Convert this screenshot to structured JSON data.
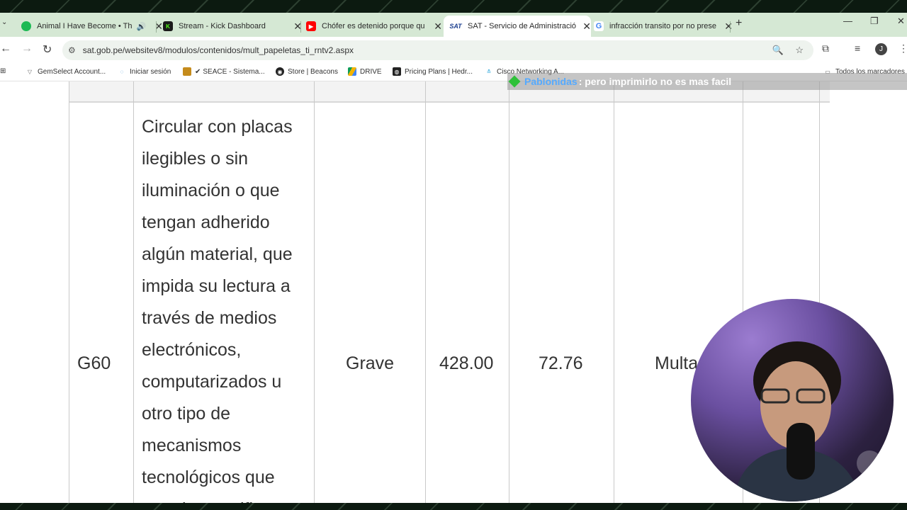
{
  "browser": {
    "tabs": [
      {
        "title": "Animal I Have Become • Th",
        "icon": "spotify-icon",
        "color": "#1db954"
      },
      {
        "title": "Stream - Kick Dashboard",
        "icon": "kick-icon",
        "color": "#1a1a1a"
      },
      {
        "title": "Chófer es detenido porque qu",
        "icon": "youtube-icon",
        "color": "#ff0000"
      },
      {
        "title": "SAT - Servicio de Administració",
        "icon": "sat-icon",
        "color": "#1c3f8f",
        "active": true
      },
      {
        "title": "infracción transito por no prese",
        "icon": "google-icon",
        "color": "#4285f4"
      }
    ],
    "new_tab": "+",
    "url": "sat.gob.pe/websitev8/modulos/contenidos/mult_papeletas_ti_rntv2.aspx",
    "profile_initial": "J",
    "bookmarks": [
      "GemSelect Account...",
      "Iniciar sesión",
      "SEACE - Sistema...",
      "Store | Beacons",
      "DRIVE",
      "Pricing Plans | Hedr...",
      "Cisco Networking A..."
    ],
    "all_bookmarks": "Todos los marcadores"
  },
  "table": {
    "row": {
      "code": "G60",
      "description_lines": [
        "Circular con placas",
        "ilegibles o sin",
        "iluminación o que",
        "tengan adherido",
        "algún material, que",
        "impida su lectura a",
        "través de medios",
        "electrónicos,",
        "computarizados u",
        "otro tipo de",
        "mecanismos",
        "tecnológicos que",
        "permitan verific"
      ],
      "severity": "Grave",
      "amount": "428.00",
      "percent": "72.76",
      "sanction": "Multa"
    }
  },
  "chat": {
    "user": "Pablonidas",
    "message": ": pero imprimirlo no es mas facil"
  },
  "colors": {
    "tabstrip": "#d5e8d4",
    "chat_user": "#55aaff"
  }
}
